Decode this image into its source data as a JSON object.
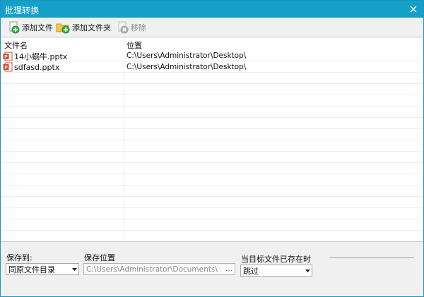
{
  "window": {
    "title": "批理转换"
  },
  "toolbar": {
    "add_file_label": "添加文件",
    "add_folder_label": "添加文件夹",
    "remove_label": "移除"
  },
  "list": {
    "columns": [
      "文件名",
      "位置"
    ],
    "rows": [
      {
        "name": "14小蜗牛.pptx",
        "location": "C:\\Users\\Administrator\\Desktop\\"
      },
      {
        "name": "sdfasd.pptx",
        "location": "C:\\Users\\Administrator\\Desktop\\"
      }
    ]
  },
  "bottom": {
    "save_to_label": "保存到:",
    "save_to_value": "同原文件目录",
    "save_location_label": "保存位置",
    "save_location_value": "C:\\Users\\Administrator\\Documents\\",
    "browse_label": "...",
    "exists_label": "当目标文件已存在时",
    "exists_value": "跳过"
  },
  "colors": {
    "titlebar": "#14a0c9",
    "ppt_icon": "#d24726"
  }
}
